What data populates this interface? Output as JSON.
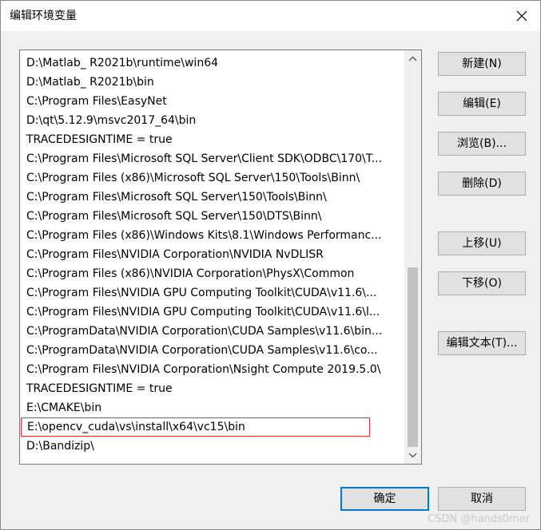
{
  "window": {
    "title": "编辑环境变量",
    "close_icon": "close-icon"
  },
  "path_list": {
    "items": [
      "D:\\Matlab_ R2021b\\runtime\\win64",
      "D:\\Matlab_ R2021b\\bin",
      "C:\\Program Files\\EasyNet",
      "D:\\qt\\5.12.9\\msvc2017_64\\bin",
      "TRACEDESIGNTIME = true",
      "C:\\Program Files\\Microsoft SQL Server\\Client SDK\\ODBC\\170\\T...",
      "C:\\Program Files (x86)\\Microsoft SQL Server\\150\\Tools\\Binn\\",
      "C:\\Program Files\\Microsoft SQL Server\\150\\Tools\\Binn\\",
      "C:\\Program Files\\Microsoft SQL Server\\150\\DTS\\Binn\\",
      "C:\\Program Files (x86)\\Windows Kits\\8.1\\Windows Performanc...",
      "C:\\Program Files\\NVIDIA Corporation\\NVIDIA NvDLISR",
      "C:\\Program Files (x86)\\NVIDIA Corporation\\PhysX\\Common",
      "C:\\Program Files\\NVIDIA GPU Computing Toolkit\\CUDA\\v11.6\\...",
      "C:\\Program Files\\NVIDIA GPU Computing Toolkit\\CUDA\\v11.6\\l...",
      "C:\\ProgramData\\NVIDIA Corporation\\CUDA Samples\\v11.6\\bin...",
      "C:\\ProgramData\\NVIDIA Corporation\\CUDA Samples\\v11.6\\co...",
      "C:\\Program Files\\NVIDIA Corporation\\Nsight Compute 2019.5.0\\",
      "TRACEDESIGNTIME = true",
      "E:\\CMAKE\\bin",
      "E:\\opencv_cuda\\vs\\install\\x64\\vc15\\bin",
      "D:\\Bandizip\\"
    ],
    "highlighted_index": 19,
    "highlight_color": "#e0312c",
    "scroll_up_icon": "chevron-up-icon",
    "scroll_down_icon": "chevron-down-icon"
  },
  "side_buttons": {
    "new_label": "新建(N)",
    "edit_label": "编辑(E)",
    "browse_label": "浏览(B)...",
    "delete_label": "删除(D)",
    "move_up_label": "上移(U)",
    "move_down_label": "下移(O)",
    "edit_text_label": "编辑文本(T)..."
  },
  "footer": {
    "ok_label": "确定",
    "cancel_label": "取消"
  },
  "watermark": "CSDN @hands0mer",
  "colors": {
    "accent": "#0078d7",
    "button_face": "#e1e1e1",
    "dialog_bg": "#f0f0f0"
  }
}
